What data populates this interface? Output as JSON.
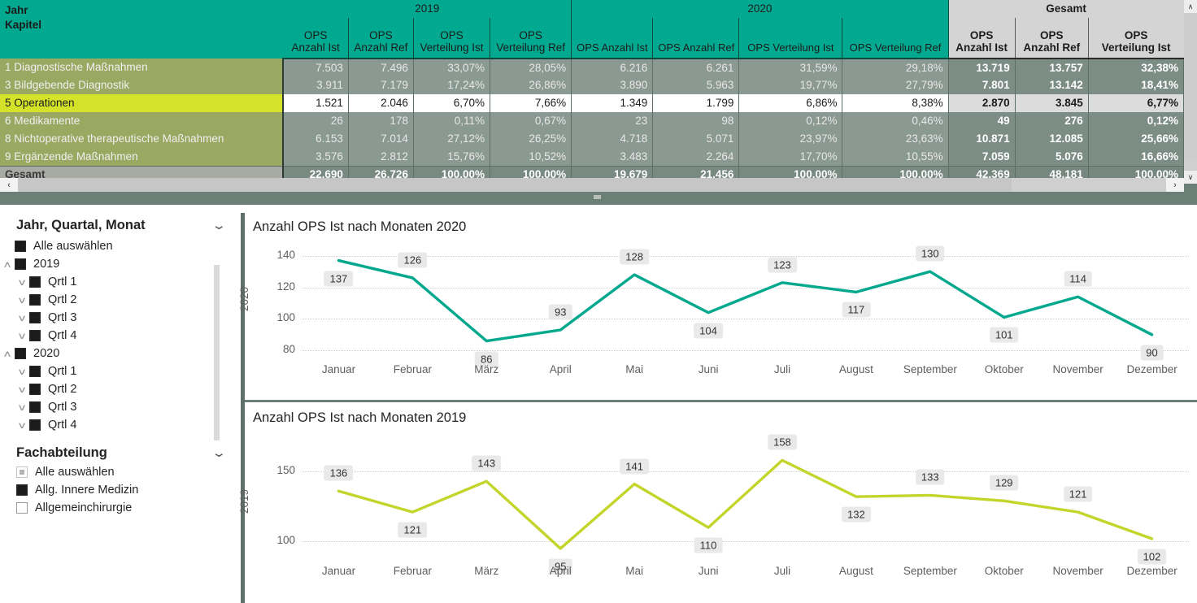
{
  "matrix": {
    "corner": {
      "line1": "Jahr",
      "line2": "Kapitel"
    },
    "groups": [
      {
        "label": "2019",
        "span": 4
      },
      {
        "label": "2020",
        "span": 4
      },
      {
        "label": "Gesamt",
        "span": 3
      }
    ],
    "columns": [
      "OPS Anzahl Ist",
      "OPS Anzahl Ref",
      "OPS Verteilung Ist",
      "OPS Verteilung Ref",
      "OPS Anzahl Ist",
      "OPS Anzahl Ref",
      "OPS Verteilung Ist",
      "OPS Verteilung Ref",
      "OPS Anzahl Ist",
      "OPS Anzahl Ref",
      "OPS Verteilung Ist"
    ],
    "rows": [
      {
        "label": "1 Diagnostische Maßnahmen",
        "selected": false,
        "total": false,
        "cells": [
          "7.503",
          "7.496",
          "33,07%",
          "28,05%",
          "6.216",
          "6.261",
          "31,59%",
          "29,18%",
          "13.719",
          "13.757",
          "32,38%"
        ]
      },
      {
        "label": "3 Bildgebende Diagnostik",
        "selected": false,
        "total": false,
        "cells": [
          "3.911",
          "7.179",
          "17,24%",
          "26,86%",
          "3.890",
          "5.963",
          "19,77%",
          "27,79%",
          "7.801",
          "13.142",
          "18,41%"
        ]
      },
      {
        "label": "5 Operationen",
        "selected": true,
        "total": false,
        "cells": [
          "1.521",
          "2.046",
          "6,70%",
          "7,66%",
          "1.349",
          "1.799",
          "6,86%",
          "8,38%",
          "2.870",
          "3.845",
          "6,77%"
        ]
      },
      {
        "label": "6 Medikamente",
        "selected": false,
        "total": false,
        "cells": [
          "26",
          "178",
          "0,11%",
          "0,67%",
          "23",
          "98",
          "0,12%",
          "0,46%",
          "49",
          "276",
          "0,12%"
        ]
      },
      {
        "label": "8 Nichtoperative therapeutische Maßnahmen",
        "selected": false,
        "total": false,
        "cells": [
          "6.153",
          "7.014",
          "27,12%",
          "26,25%",
          "4.718",
          "5.071",
          "23,97%",
          "23,63%",
          "10.871",
          "12.085",
          "25,66%"
        ]
      },
      {
        "label": "9 Ergänzende Maßnahmen",
        "selected": false,
        "total": false,
        "cells": [
          "3.576",
          "2.812",
          "15,76%",
          "10,52%",
          "3.483",
          "2.264",
          "17,70%",
          "10,55%",
          "7.059",
          "5.076",
          "16,66%"
        ]
      },
      {
        "label": "Gesamt",
        "selected": false,
        "total": true,
        "cells": [
          "22.690",
          "26.726",
          "100,00%",
          "100,00%",
          "19.679",
          "21.456",
          "100,00%",
          "100,00%",
          "42.369",
          "48.181",
          "100,00%"
        ]
      }
    ],
    "scroll": {
      "up_arrow": "∧",
      "down_arrow": "∨",
      "left_arrow": "‹",
      "right_arrow": "›"
    },
    "colors": {
      "header": "#00a98f",
      "gesamt_header": "#d4d4d4",
      "selected_row": "#d4e32a",
      "row_label": "#9aa862"
    }
  },
  "slicers": [
    {
      "title": "Jahr, Quartal, Monat",
      "chevron": "⌄",
      "items": [
        {
          "label": "Alle auswählen",
          "level": 1,
          "state": "checked",
          "expander": "none"
        },
        {
          "label": "2019",
          "level": 1,
          "state": "checked",
          "expander": "up"
        },
        {
          "label": "Qrtl 1",
          "level": 2,
          "state": "checked",
          "expander": "down"
        },
        {
          "label": "Qrtl 2",
          "level": 2,
          "state": "checked",
          "expander": "down"
        },
        {
          "label": "Qrtl 3",
          "level": 2,
          "state": "checked",
          "expander": "down"
        },
        {
          "label": "Qrtl 4",
          "level": 2,
          "state": "checked",
          "expander": "down"
        },
        {
          "label": "2020",
          "level": 1,
          "state": "checked",
          "expander": "up"
        },
        {
          "label": "Qrtl 1",
          "level": 2,
          "state": "checked",
          "expander": "down"
        },
        {
          "label": "Qrtl 2",
          "level": 2,
          "state": "checked",
          "expander": "down"
        },
        {
          "label": "Qrtl 3",
          "level": 2,
          "state": "checked",
          "expander": "down"
        },
        {
          "label": "Qrtl 4",
          "level": 2,
          "state": "checked",
          "expander": "down"
        }
      ]
    },
    {
      "title": "Fachabteilung",
      "chevron": "⌄",
      "items": [
        {
          "label": "Alle auswählen",
          "level": 0,
          "state": "partial",
          "expander": "none"
        },
        {
          "label": "Allg. Innere Medizin",
          "level": 0,
          "state": "checked",
          "expander": "none"
        },
        {
          "label": "Allgemeinchirurgie",
          "level": 0,
          "state": "unchecked",
          "expander": "none"
        }
      ]
    }
  ],
  "chart_data": [
    {
      "type": "line",
      "title": "Anzahl OPS Ist nach Monaten 2020",
      "ylabel": "2020",
      "xlabel": "",
      "categories": [
        "Januar",
        "Februar",
        "März",
        "April",
        "Mai",
        "Juni",
        "Juli",
        "August",
        "September",
        "Oktober",
        "November",
        "Dezember"
      ],
      "values": [
        137,
        126,
        86,
        93,
        128,
        104,
        123,
        117,
        130,
        101,
        114,
        90
      ],
      "yticks": [
        80,
        100,
        120,
        140
      ],
      "ylim": [
        76,
        144
      ],
      "grid": true,
      "legend": "none",
      "color": "#01a88e",
      "label_positions": [
        "below",
        "above",
        "below",
        "above",
        "above",
        "below",
        "above",
        "below",
        "above",
        "below",
        "above",
        "below"
      ]
    },
    {
      "type": "line",
      "title": "Anzahl OPS Ist nach Monaten 2019",
      "ylabel": "2019",
      "xlabel": "",
      "categories": [
        "Januar",
        "Februar",
        "März",
        "April",
        "Mai",
        "Juni",
        "Juli",
        "August",
        "September",
        "Oktober",
        "November",
        "Dezember"
      ],
      "values": [
        136,
        121,
        143,
        95,
        141,
        110,
        158,
        132,
        133,
        129,
        121,
        102
      ],
      "yticks": [
        100,
        150
      ],
      "ylim": [
        88,
        164
      ],
      "grid": true,
      "legend": "none",
      "color": "#c3d52a",
      "label_positions": [
        "above",
        "below",
        "above",
        "below",
        "above",
        "below",
        "above",
        "below",
        "above",
        "above",
        "above",
        "below"
      ]
    }
  ]
}
